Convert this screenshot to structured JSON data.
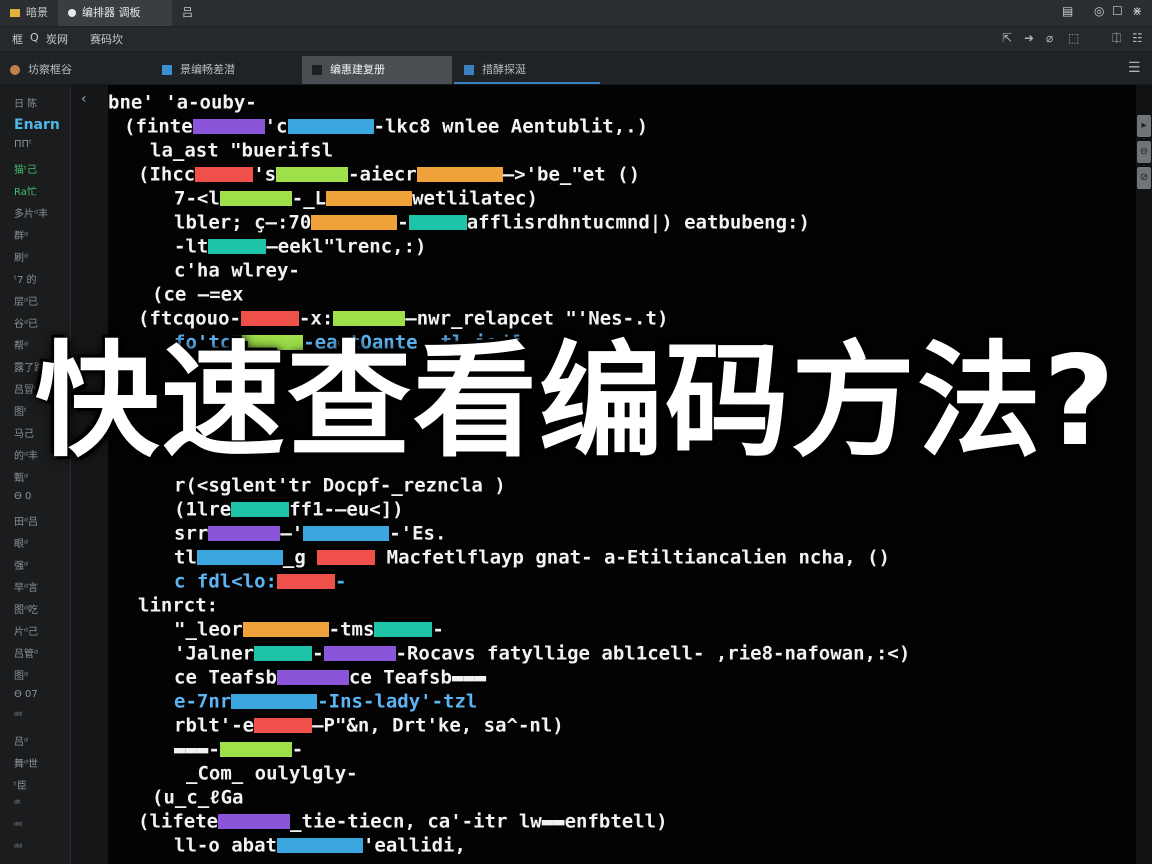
{
  "titlebar": {
    "tabs": [
      {
        "label": "暗景"
      },
      {
        "label": "编排器 调板"
      },
      {
        "label": "吕"
      }
    ],
    "window_controls": [
      "▤",
      "◎",
      "☐",
      "⋇"
    ]
  },
  "menubar": {
    "items": [
      "框",
      "Q",
      "炭网",
      "赛码坎"
    ],
    "tools": [
      "⇱",
      "➜",
      "⌀",
      "⬚",
      "⎅",
      "☷"
    ]
  },
  "editor_tabs": [
    {
      "label": "坊察框谷"
    },
    {
      "label": "景编畅差潜"
    },
    {
      "label": "编惠建复册"
    },
    {
      "label": "措酵探涎"
    }
  ],
  "sidebar": {
    "items": [
      "日 陈",
      "Enarn",
      "ΠΠᵗ",
      "猫ᵗ己",
      "Ra忙",
      "多片ᵈ丰",
      "群ᵈ",
      "刷ᵈ",
      "ᵗ7 的",
      "层ᵈ已",
      "谷ᵈ已",
      "帮ᵈ",
      "露了路",
      "吕冒ᵈ",
      "图ᵗ",
      "马己",
      "的ᵈ丰",
      "甄ᵈ",
      "Θ 0",
      "田ᵈ吕",
      "眼ᵈ",
      "强ᵈ",
      "早ᵈ言",
      "图ᵈ吃",
      "片ᵈ己",
      "吕管ᵈ",
      "图ᵈ",
      "Θ 07",
      "ᵈᵈ",
      "吕ᵈ",
      "舞ᵈ世",
      "ᵗ臣",
      "ᵈᵗ",
      "ᵈᵈ",
      "ᵈᵈ"
    ]
  },
  "code_lines": [
    {
      "text": "bne'  'a-ouby-"
    },
    {
      "text": "(finte▬▬▬'c▬▬▬-lkc8  wnlee Aentublit,.)"
    },
    {
      "text": "la_ast \"buerifsl"
    },
    {
      "text": "(Ihcc▬▬▬'s▬▬▬-aiecr▬▬▬—>'be_\"et ()"
    },
    {
      "text": "7-<l▬▬▬-_L▬▬▬wetlilatec)"
    },
    {
      "text": "lbler; ç—:70▬▬▬-▬▬▬afflisrdhntucmnd|) eatbubeng:)"
    },
    {
      "text": "-lt▬▬▬—eekl\"lrenc,:)"
    },
    {
      "text": "c'ha wlrey-"
    },
    {
      "text": "(ce   —=ex"
    },
    {
      "text": "(ftcqouo-▬▬▬-x:▬▬▬—nwr_relapcet \"'Nes-.t)"
    },
    {
      "text": "fo'tc▬▬▬-eaotOante ,tl.iodf"
    },
    {
      "text": "r(<sglent'tr Docpf-_rezncla )"
    },
    {
      "text": "(1lre▬▬▬ff1-—eu<])"
    },
    {
      "text": "srr▬▬▬—'▬▬▬-'Es."
    },
    {
      "text": "tl▬▬▬_g ▬▬▬ Macfetlflayp gnat- a-Etiltiancalien ncha, ()"
    },
    {
      "text": "c fdl<lo:▬▬▬-"
    },
    {
      "text": "linrct:"
    },
    {
      "text": "\"_leor▬▬▬-tms▬▬▬-"
    },
    {
      "text": "'Jalner▬▬▬-▬▬▬-Rocavs fatyllige abl1cell- ,rie8-nafowan,:<)"
    },
    {
      "text": "ce Teafsb▬▬▬"
    },
    {
      "text": "e-7nr▬▬▬-Ins-lady'-tzl"
    },
    {
      "text": "rblt'-e▬▬▬—P\"&n,  Drt'ke, sa^-nl)"
    },
    {
      "text": "▬▬▬-"
    },
    {
      "text": "_Com_ oulylgly-"
    },
    {
      "text": "(u_c_ℓGa"
    },
    {
      "text": "(lifete▬▬▬_tie-tiecn, ca'-itr lw▬▬enfbtell)"
    },
    {
      "text": "ll-o abat▬▬▬'eallidi,"
    }
  ],
  "overlay": {
    "text": "快速查看编码方法?"
  },
  "scrollbar": {
    "buttons": [
      "▸",
      "⊖",
      "⊘"
    ]
  },
  "colors": {
    "accent_green": "#9fe04a",
    "accent_teal": "#1fc4a8",
    "accent_purple": "#8a55d8",
    "accent_blue": "#3aa7e0",
    "accent_red": "#f0504a",
    "accent_orange": "#f0a23a"
  }
}
